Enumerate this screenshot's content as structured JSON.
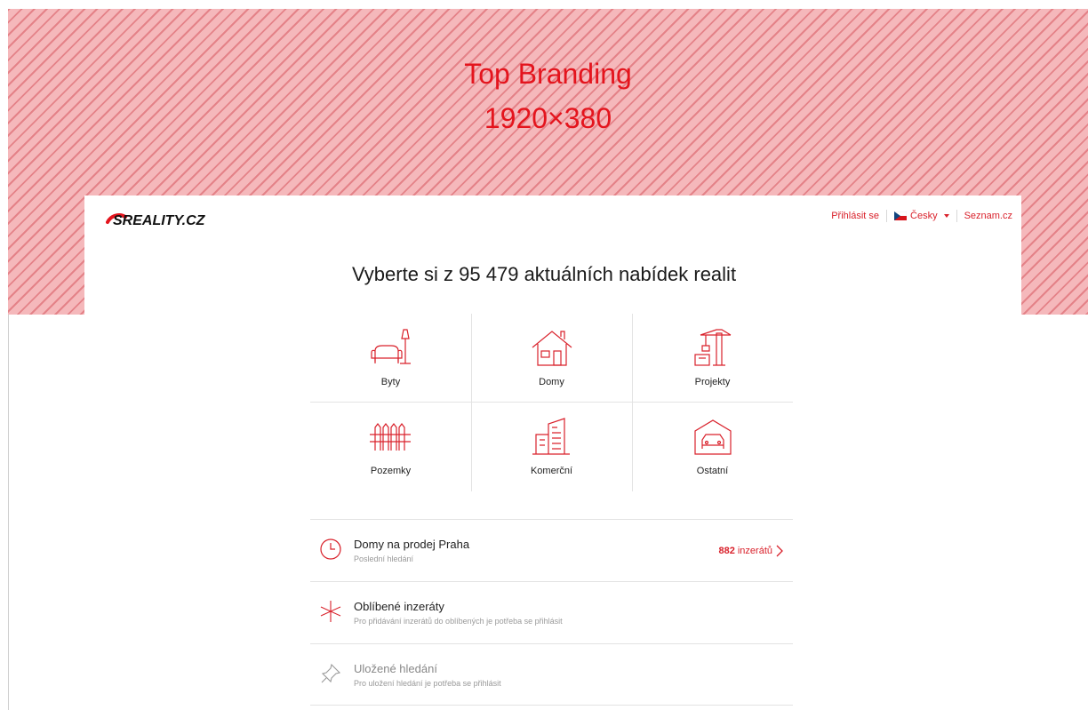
{
  "branding": {
    "line1": "Top Branding",
    "line2": "1920×380"
  },
  "header": {
    "logo_text": "SREALITY.CZ",
    "login": "Přihlásit se",
    "language": "Česky",
    "seznam": "Seznam.cz"
  },
  "headline": "Vyberte si z  95 479  aktuálních nabídek realit",
  "categories": [
    {
      "label": "Byty",
      "icon": "armchair-lamp-icon"
    },
    {
      "label": "Domy",
      "icon": "house-icon"
    },
    {
      "label": "Projekty",
      "icon": "crane-icon"
    },
    {
      "label": "Pozemky",
      "icon": "fence-icon"
    },
    {
      "label": "Komerční",
      "icon": "buildings-icon"
    },
    {
      "label": "Ostatní",
      "icon": "garage-car-icon"
    }
  ],
  "rows": [
    {
      "title": "Domy na prodej Praha",
      "subtitle": "Poslední hledání",
      "count_num": "882",
      "count_text": "inzerátů",
      "icon": "clock-icon"
    },
    {
      "title": "Oblíbené inzeráty",
      "subtitle": "Pro přidávání inzerátů do oblíbených je potřeba se přihlásit",
      "icon": "star-icon"
    },
    {
      "title": "Uložené hledání",
      "subtitle": "Pro uložení hledání je potřeba se přihlásit",
      "icon": "pin-icon"
    }
  ],
  "colors": {
    "brand": "#d9212b",
    "branding_bg": "#f5b8bb"
  }
}
